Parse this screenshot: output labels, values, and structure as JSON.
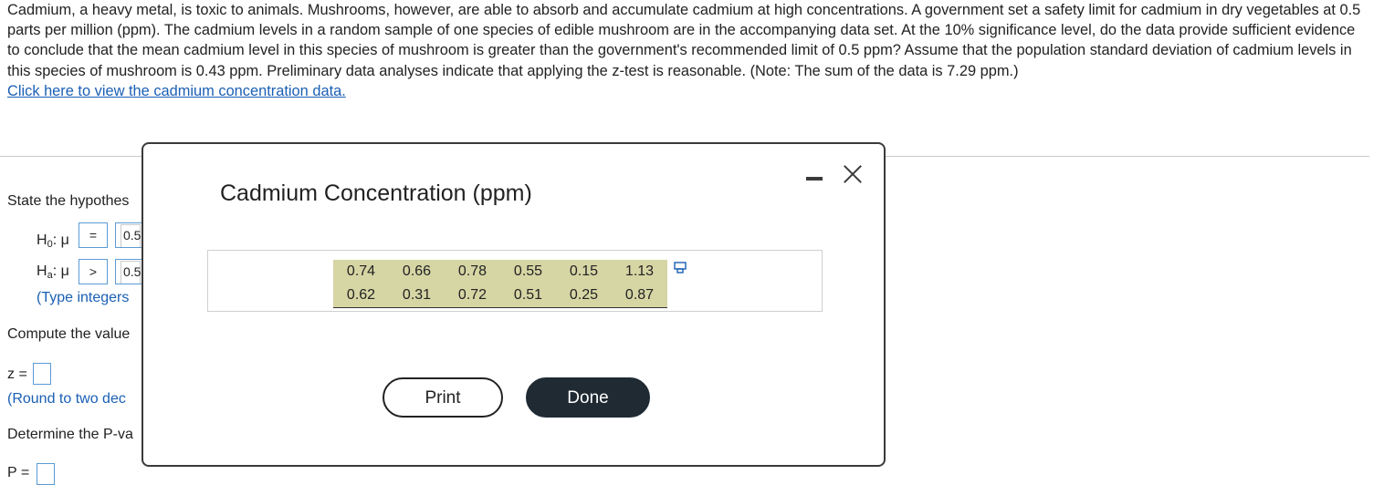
{
  "problem": {
    "text": "Cadmium, a heavy metal, is toxic to animals. Mushrooms, however, are able to absorb and accumulate cadmium at high concentrations. A government set a safety limit for cadmium in dry vegetables at 0.5 parts per million (ppm). The cadmium levels in a random sample of one species of edible mushroom are in the accompanying data set. At the 10% significance level, do the data provide sufficient evidence to conclude that the mean cadmium level in this species of mushroom is greater than the government's recommended limit of 0.5 ppm? Assume that the population standard deviation of cadmium levels in this species of mushroom is 0.43 ppm. Preliminary data analyses indicate that applying the z-test is reasonable. (Note: The sum of the data is 7.29 ppm.)",
    "link": "Click here to view the cadmium concentration data."
  },
  "left_panel": {
    "state_hypotheses": "State the hypothes",
    "h0_prefix": "H",
    "h0_sub": "0",
    "h0_mu": ": μ",
    "h0_op": "=",
    "h0_value": "0.5",
    "ha_prefix": "H",
    "ha_sub": "a",
    "ha_mu": ": μ",
    "ha_op": ">",
    "ha_value": "0.5",
    "type_note": "(Type integers",
    "compute": "Compute the value",
    "z_label": "z =",
    "round_note": "(Round to two dec",
    "determine": "Determine the P-va",
    "p_label": "P ="
  },
  "modal": {
    "title": "Cadmium Concentration (ppm)",
    "rows": [
      [
        "0.74",
        "0.66",
        "0.78",
        "0.55",
        "0.15",
        "1.13"
      ],
      [
        "0.62",
        "0.31",
        "0.72",
        "0.51",
        "0.25",
        "0.87"
      ]
    ],
    "print_label": "Print",
    "done_label": "Done"
  },
  "colors": {
    "link": "#1a5fb4",
    "table_bg": "#d6d6a5",
    "done_bg": "#1f2a33",
    "input_border": "#5b9bd5"
  }
}
